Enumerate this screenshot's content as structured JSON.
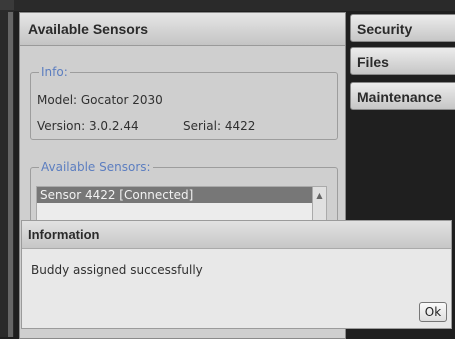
{
  "main_panel": {
    "title": "Available Sensors",
    "info": {
      "legend": "Info:",
      "model": "Model: Gocator 2030",
      "version": "Version: 3.0.2.44",
      "serial": "Serial: 4422"
    },
    "sensors": {
      "legend": "Available Sensors:",
      "items": [
        {
          "label": "Sensor 4422 [Connected]",
          "selected": true
        }
      ]
    }
  },
  "right_nav": [
    {
      "label": "Security"
    },
    {
      "label": "Files"
    },
    {
      "label": "Maintenance"
    }
  ],
  "dialog": {
    "title": "Information",
    "message": "Buddy assigned successfully",
    "ok_label": "Ok"
  },
  "colors": {
    "legend": "#5c7ec0",
    "selected_row": "#777777",
    "background": "#1f1f1f"
  }
}
